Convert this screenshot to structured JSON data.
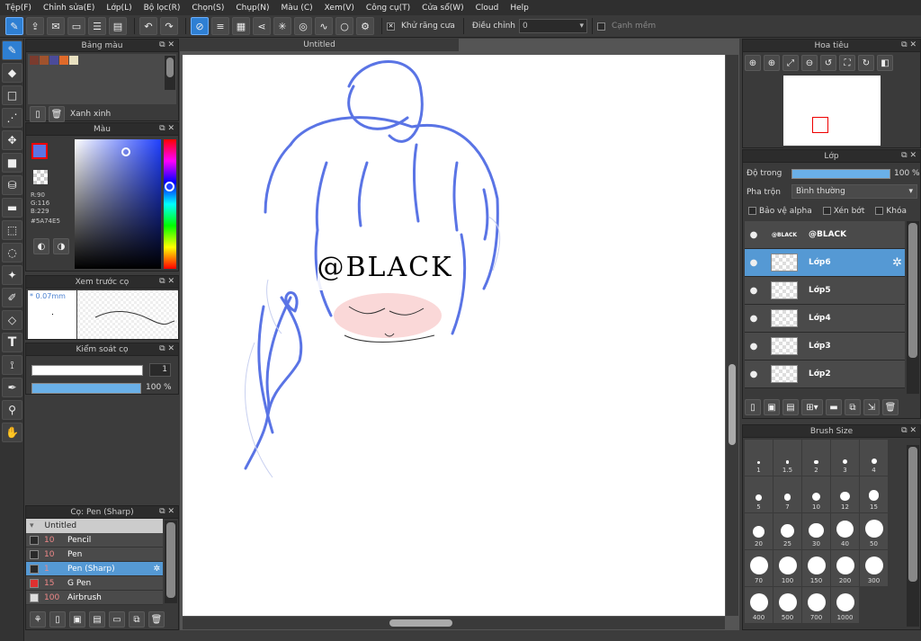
{
  "menu": [
    "Tệp(F)",
    "Chỉnh sửa(E)",
    "Lớp(L)",
    "Bộ lọc(R)",
    "Chọn(S)",
    "Chụp(N)",
    "Màu (C)",
    "Xem(V)",
    "Công cụ(T)",
    "Cửa sổ(W)",
    "Cloud",
    "Help"
  ],
  "toolbar": {
    "antialias_label": "Khử răng cưa",
    "adjust_label": "Điều chỉnh",
    "adjust_value": "0",
    "smooth_label": "Cạnh mềm"
  },
  "palette_panel": {
    "title": "Bảng màu",
    "swatch_name": "Xanh xinh",
    "swatches": [
      "#7a3b2e",
      "#a0522d",
      "#4b4b9a",
      "#e06a2a",
      "#e8e0c0"
    ]
  },
  "color_panel": {
    "title": "Màu",
    "r": "R:90",
    "g": "G:116",
    "b": "B:229",
    "hex": "#5A74E5",
    "fg": "#5a74e5"
  },
  "brush_preview": {
    "title": "Xem trước cọ",
    "size": "* 0.07mm"
  },
  "brush_control": {
    "title": "Kiểm soát cọ",
    "size_value": "1",
    "opacity_value": "100 %"
  },
  "canvas": {
    "tab_title": "Untitled",
    "watermark": "@BLACK",
    "stroke": "#5a74e5"
  },
  "navigator": {
    "title": "Hoa tiêu"
  },
  "layers_panel": {
    "title": "Lớp",
    "opacity_label": "Độ trong",
    "opacity_value": "100 %",
    "blend_label": "Pha trộn",
    "blend_value": "Bình thường",
    "protect_alpha": "Bảo vệ alpha",
    "clipping": "Xén bớt",
    "lock": "Khóa",
    "layers": [
      {
        "name": "@BLACK",
        "selected": false
      },
      {
        "name": "Lớp6",
        "selected": true
      },
      {
        "name": "Lớp5",
        "selected": false
      },
      {
        "name": "Lớp4",
        "selected": false
      },
      {
        "name": "Lớp3",
        "selected": false
      },
      {
        "name": "Lớp2",
        "selected": false
      }
    ]
  },
  "brush_size_panel": {
    "title": "Brush Size",
    "sizes": [
      "1",
      "1.5",
      "2",
      "3",
      "4",
      "5",
      "7",
      "10",
      "12",
      "15",
      "20",
      "25",
      "30",
      "40",
      "50",
      "70",
      "100",
      "150",
      "200",
      "300",
      "400",
      "500",
      "700",
      "1000"
    ]
  },
  "brush_list": {
    "title": "Cọ: Pen (Sharp)",
    "group": "Untitled",
    "items": [
      {
        "size": "10",
        "name": "Pencil",
        "color": "#2a2a2a",
        "selected": false
      },
      {
        "size": "10",
        "name": "Pen",
        "color": "#2a2a2a",
        "selected": false
      },
      {
        "size": "1",
        "name": "Pen (Sharp)",
        "color": "#2a2a2a",
        "selected": true
      },
      {
        "size": "15",
        "name": "G Pen",
        "color": "#e03030",
        "selected": false
      },
      {
        "size": "100",
        "name": "Airbrush",
        "color": "#dddddd",
        "selected": false
      }
    ]
  }
}
